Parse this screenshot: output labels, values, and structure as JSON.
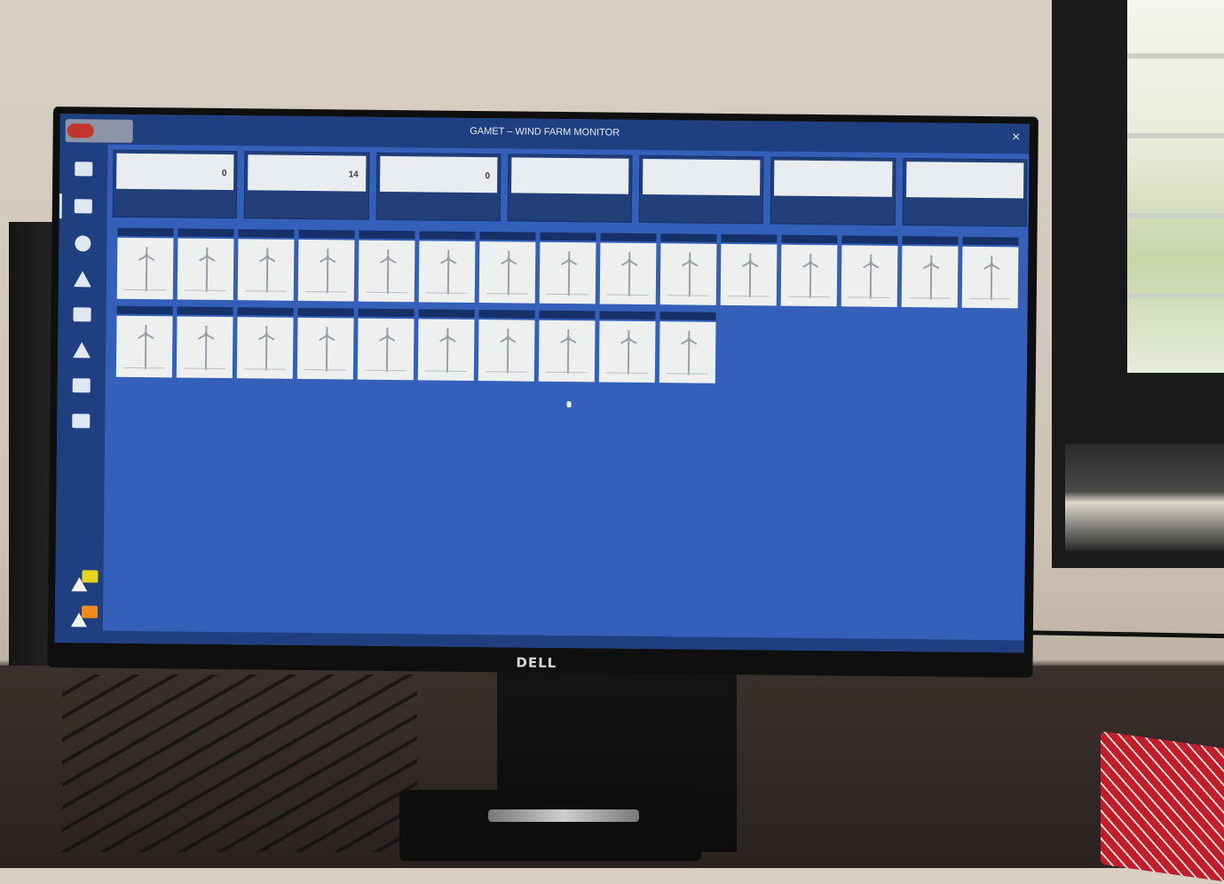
{
  "window": {
    "title": "GAMET – WIND FARM MONITOR",
    "close_glyph": "✕"
  },
  "brand": {
    "monitor_logo": "DELL"
  },
  "sidebar": {
    "items": [
      {
        "icon": "dashboard-icon"
      },
      {
        "icon": "list-icon"
      },
      {
        "icon": "globe-icon"
      },
      {
        "icon": "turbine-icon"
      },
      {
        "icon": "grid-icon"
      },
      {
        "icon": "upload-icon"
      },
      {
        "icon": "server-icon"
      },
      {
        "icon": "monitor-icon"
      }
    ],
    "alerts": [
      {
        "icon": "warning-icon",
        "color": "#e8d41c"
      },
      {
        "icon": "alarm-icon",
        "color": "#f08a1c"
      }
    ]
  },
  "kpis": [
    {
      "value": "0",
      "label": ""
    },
    {
      "value": "14",
      "label": ""
    },
    {
      "value": "0",
      "label": ""
    },
    {
      "value": "",
      "label": ""
    },
    {
      "value": "",
      "label": ""
    },
    {
      "value": "",
      "label": ""
    },
    {
      "value": "",
      "label": ""
    }
  ],
  "tiles": [
    {
      "label": "",
      "status": "green"
    },
    {
      "label": "",
      "status": "green"
    },
    {
      "label": "",
      "status": "green"
    },
    {
      "label": "",
      "status": "green"
    },
    {
      "label": "",
      "status": "green"
    },
    {
      "label": "",
      "status": "green"
    },
    {
      "label": "",
      "status": "green"
    },
    {
      "label": "",
      "status": "green"
    },
    {
      "label": "",
      "status": "green"
    },
    {
      "label": "",
      "status": "green"
    },
    {
      "label": "",
      "status": "green"
    },
    {
      "label": "",
      "status": "green"
    },
    {
      "label": "",
      "status": "green"
    },
    {
      "label": "",
      "status": "green"
    },
    {
      "label": "",
      "status": "green"
    },
    {
      "label": "",
      "status": "green"
    },
    {
      "label": "",
      "status": "green"
    },
    {
      "label": "",
      "status": "green"
    },
    {
      "label": "",
      "status": "red"
    },
    {
      "label": "",
      "status": "green"
    },
    {
      "label": "",
      "status": "green"
    },
    {
      "label": "",
      "status": "green"
    },
    {
      "label": "",
      "status": "green"
    },
    {
      "label": "",
      "status": "green"
    },
    {
      "label": "",
      "status": "white"
    }
  ],
  "watermark": {
    "line1": "",
    "line2": ""
  },
  "status": {
    "left": "",
    "right": ""
  },
  "colors": {
    "screen_bg": "#3460b9",
    "panel": "#1f3f80",
    "ok": "#42c464",
    "fault": "#ff5a5a"
  }
}
